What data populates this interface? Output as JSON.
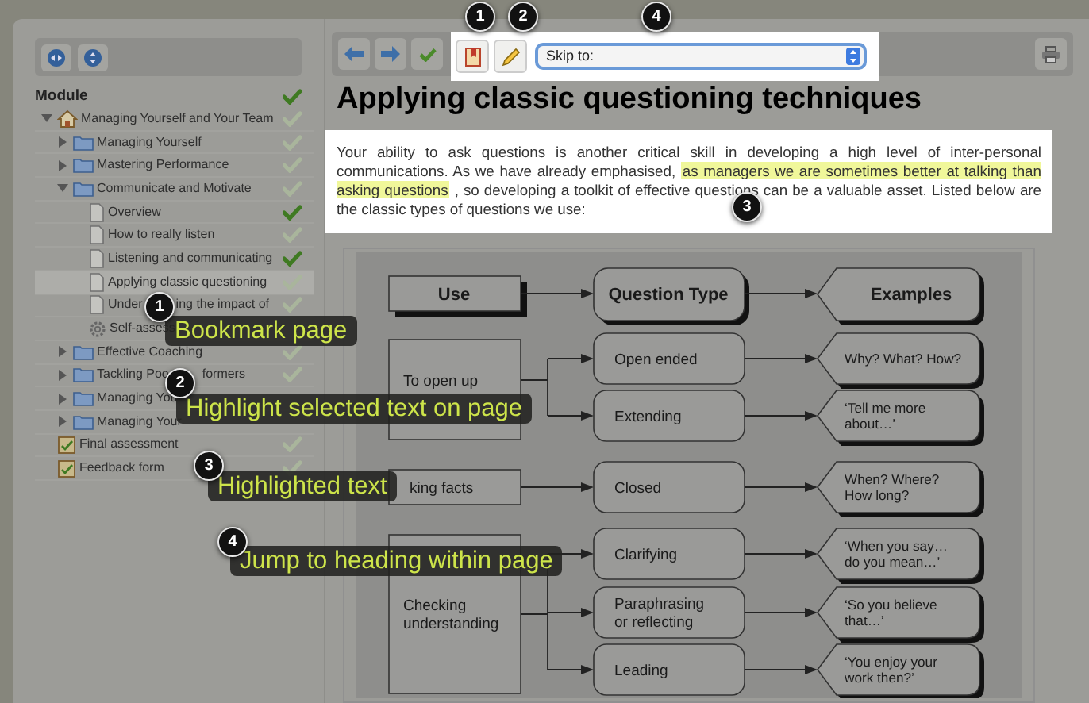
{
  "sidebar": {
    "heading": "Module",
    "heading_done": true,
    "tree": [
      {
        "label": [
          "Managing Yourself and Your Team"
        ],
        "kind": "home",
        "expanded": true,
        "done": false,
        "selected": false,
        "children": [
          {
            "label": [
              "Managing Yourself"
            ],
            "kind": "folder",
            "expanded": false,
            "done": false,
            "selected": false
          },
          {
            "label": [
              "Mastering Performance"
            ],
            "kind": "folder",
            "expanded": false,
            "done": false,
            "selected": false
          },
          {
            "label": [
              "Communicate and Motivate"
            ],
            "kind": "folder",
            "expanded": true,
            "done": false,
            "selected": false,
            "children": [
              {
                "label": [
                  "Overview"
                ],
                "kind": "page",
                "done": true,
                "selected": false
              },
              {
                "label": [
                  "How to really listen"
                ],
                "kind": "page",
                "done": false,
                "selected": false
              },
              {
                "label": [
                  "Listening and communicating"
                ],
                "kind": "page",
                "done": true,
                "selected": false
              },
              {
                "label": [
                  "Applying classic questioning"
                ],
                "kind": "page",
                "done": false,
                "selected": true
              },
              {
                "label": [
                  "Under",
                  "ing the impact of"
                ],
                "kind": "page",
                "done": false,
                "selected": false
              },
              {
                "label": [
                  "Self-assess"
                ],
                "kind": "gear",
                "selected": false
              }
            ]
          },
          {
            "label": [
              "Effective Coaching"
            ],
            "kind": "folder",
            "expanded": false,
            "done": false,
            "selected": false
          },
          {
            "label": [
              "Tackling Poo",
              "formers"
            ],
            "kind": "folder",
            "expanded": false,
            "done": false,
            "selected": false
          },
          {
            "label": [
              "Managing You"
            ],
            "kind": "folder",
            "expanded": false,
            "selected": false
          },
          {
            "label": [
              "Managing Your"
            ],
            "kind": "folder",
            "expanded": false,
            "selected": false
          }
        ]
      },
      {
        "label": [
          "Final assessment"
        ],
        "kind": "form",
        "done": false,
        "selected": false
      },
      {
        "label": [
          "Feedback form"
        ],
        "kind": "form",
        "done": false,
        "selected": false
      }
    ]
  },
  "toolbar": {
    "skip_select": {
      "value": "Skip to:"
    }
  },
  "title": "Applying classic questioning techniques",
  "paragraph": [
    {
      "text": "Your ability to ask questions is another critical skill in developing a high level of inter-personal communications. As we have already emphasised, ",
      "highlighted": false
    },
    {
      "text": "as managers we are sometimes better at talking than asking questions",
      "highlighted": true
    },
    {
      "text": " , so developing a toolkit of effective questions can be a valuable asset. Listed below are the classic types of questions we use:",
      "highlighted": false
    }
  ],
  "diagram": {
    "headers": [
      "Use",
      "Question Type",
      "Examples"
    ],
    "uses": [
      {
        "label": [
          "To open up"
        ],
        "types": [
          {
            "type": [
              "Open ended"
            ],
            "example": [
              "Why? What? How?"
            ]
          },
          {
            "type": [
              "Extending"
            ],
            "example": [
              "‘Tell me more",
              "about…’"
            ]
          }
        ]
      },
      {
        "label": [
          "king facts"
        ],
        "types": [
          {
            "type": [
              "Closed"
            ],
            "example": [
              "When? Where?",
              "How long?"
            ]
          }
        ]
      },
      {
        "label": [
          "Checking",
          "understanding"
        ],
        "types": [
          {
            "type": [
              "Clarifying"
            ],
            "example": [
              "‘When you say…",
              "do you mean…’"
            ]
          },
          {
            "type": [
              "Paraphrasing",
              "or reflecting"
            ],
            "example": [
              "‘So you believe",
              "that…’"
            ]
          },
          {
            "type": [
              "Leading"
            ],
            "example": [
              "‘You enjoy your",
              "work then?’"
            ]
          }
        ]
      }
    ]
  },
  "markers": [
    {
      "number": "1"
    },
    {
      "number": "2"
    },
    {
      "number": "4"
    },
    {
      "number": "3"
    }
  ],
  "callouts": [
    {
      "number": "1",
      "text": "Bookmark page"
    },
    {
      "number": "2",
      "text": "Highlight selected text on page"
    },
    {
      "number": "3",
      "text": "Highlighted text"
    },
    {
      "number": "4",
      "text": "Jump to heading within page"
    }
  ]
}
